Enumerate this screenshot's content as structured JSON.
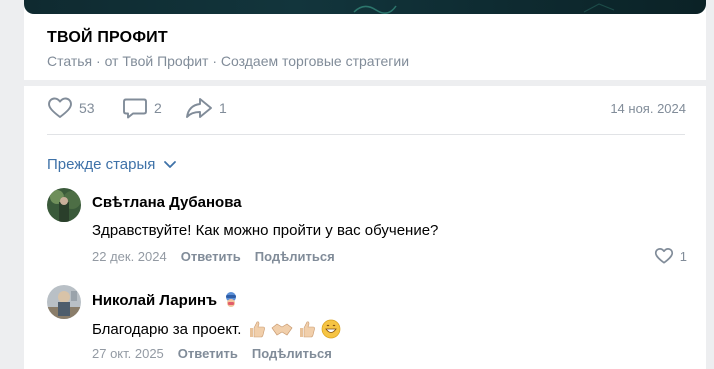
{
  "article": {
    "title": "ТВОЙ ПРОФИТ",
    "subtitle": "Статья · от Твой Профит · Создаем торговые стратегии"
  },
  "actions": {
    "likes": "53",
    "comments": "2",
    "shares": "1",
    "date": "14 ноя. 2024"
  },
  "sort": {
    "label": "Прежде старыя"
  },
  "comments": [
    {
      "author": "Свѣтлана Дубанова",
      "text": "Здравствуйте! Как можно пройти у вас обучение?",
      "date": "22 дек. 2024",
      "reply": "Ответить",
      "share": "Подѣлиться",
      "likes": "1"
    },
    {
      "author": "Николай Ларинъ",
      "text": "Благодарю за проект.",
      "date": "27 окт. 2025",
      "reply": "Ответить",
      "share": "Подѣлиться",
      "likes": ""
    }
  ],
  "colors": {
    "link": "#3f72a8",
    "muted": "#818c99",
    "divider": "#e1e3e6",
    "background": "#edeef0"
  },
  "icons": [
    "heart-icon",
    "comment-icon",
    "share-icon",
    "chevron-down-icon",
    "heart-outline-icon",
    "mask-emoji-icon",
    "thumbs-up-emoji",
    "handshake-emoji",
    "grin-emoji"
  ]
}
